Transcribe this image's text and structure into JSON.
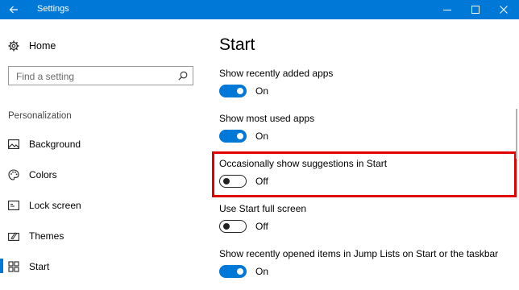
{
  "window": {
    "title": "Settings",
    "icons": {
      "back": "back-arrow-icon",
      "minimize": "minimize-icon",
      "maximize": "maximize-icon",
      "close": "close-icon"
    },
    "accent": "#0078d7"
  },
  "sidebar": {
    "home_label": "Home",
    "search_placeholder": "Find a setting",
    "section_header": "Personalization",
    "items": [
      {
        "label": "Background",
        "icon": "picture-icon",
        "selected": false
      },
      {
        "label": "Colors",
        "icon": "palette-icon",
        "selected": false
      },
      {
        "label": "Lock screen",
        "icon": "lock-screen-icon",
        "selected": false
      },
      {
        "label": "Themes",
        "icon": "themes-icon",
        "selected": false
      },
      {
        "label": "Start",
        "icon": "start-icon",
        "selected": true
      }
    ]
  },
  "main": {
    "title": "Start",
    "settings": [
      {
        "label": "Show recently added apps",
        "state": "On",
        "on": true
      },
      {
        "label": "Show most used apps",
        "state": "On",
        "on": true
      },
      {
        "label": "Occasionally show suggestions in Start",
        "state": "Off",
        "on": false,
        "highlighted": true
      },
      {
        "label": "Use Start full screen",
        "state": "Off",
        "on": false
      },
      {
        "label": "Show recently opened items in Jump Lists on Start or the taskbar",
        "state": "On",
        "on": true
      }
    ]
  },
  "highlight_color": "#e00000"
}
